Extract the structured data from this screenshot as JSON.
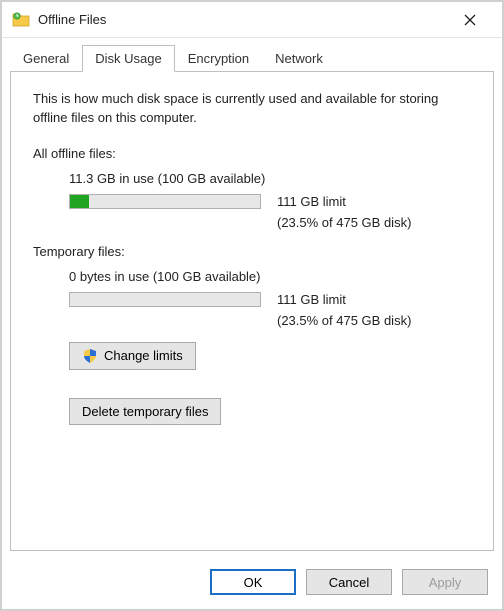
{
  "window": {
    "title": "Offline Files"
  },
  "tabs": {
    "items": [
      "General",
      "Disk Usage",
      "Encryption",
      "Network"
    ],
    "active_index": 1
  },
  "panel": {
    "description": "This is how much disk space is currently used and available for storing offline files on this computer.",
    "all_offline": {
      "label": "All offline files:",
      "usage_text": "11.3 GB in use (100 GB available)",
      "limit_text": "111 GB limit",
      "pct_text": "(23.5% of 475 GB disk)",
      "fill_pct": 10
    },
    "temporary": {
      "label": "Temporary files:",
      "usage_text": "0 bytes in use (100 GB available)",
      "limit_text": "111 GB limit",
      "pct_text": "(23.5% of 475 GB disk)",
      "fill_pct": 0
    },
    "change_limits_label": "Change limits",
    "delete_temp_label": "Delete temporary files"
  },
  "footer": {
    "ok": "OK",
    "cancel": "Cancel",
    "apply": "Apply"
  }
}
